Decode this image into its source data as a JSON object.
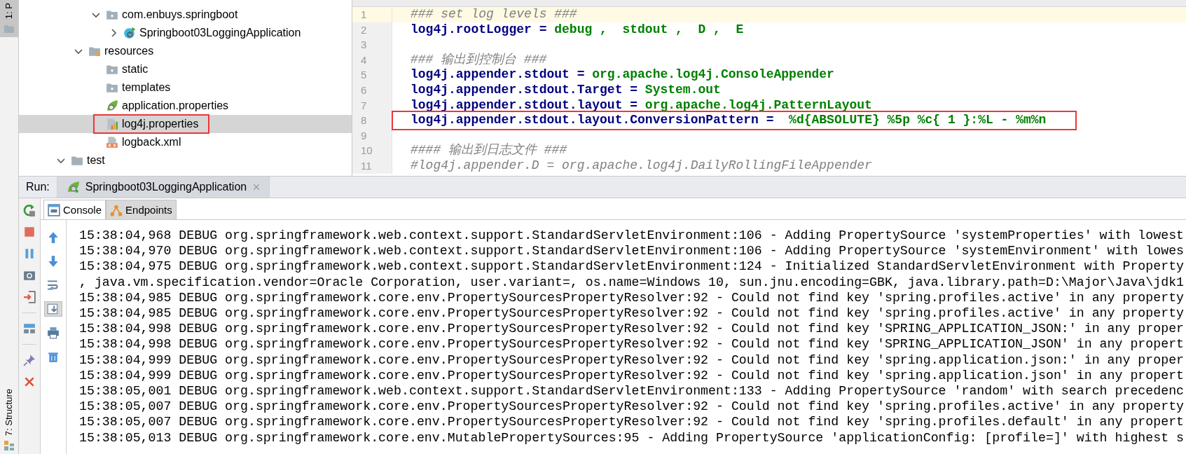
{
  "side_stripe": {
    "top_tab": {
      "label": "1: P",
      "selected": true
    },
    "bottom_tab": {
      "label": "7: Structure",
      "selected": false
    }
  },
  "project_tree": {
    "items": [
      {
        "children": [
          {
            "children": [
              {
                "label": "com.enbuys.springboot",
                "kind": "package",
                "expanded": true,
                "selected": false,
                "highlighted": false,
                "children": [
                  {
                    "label": "Springboot03LoggingApplication",
                    "kind": "spring-class",
                    "expanded": false,
                    "selected": false,
                    "highlighted": false
                  }
                ]
              }
            ]
          },
          {
            "label": "resources",
            "kind": "resources-folder",
            "expanded": true,
            "selected": false,
            "highlighted": false,
            "children": [
              {
                "label": "static",
                "kind": "package",
                "selected": false,
                "highlighted": false
              },
              {
                "label": "templates",
                "kind": "package",
                "selected": false,
                "highlighted": false
              },
              {
                "label": "application.properties",
                "kind": "spring-properties",
                "selected": false,
                "highlighted": false
              },
              {
                "label": "log4j.properties",
                "kind": "properties",
                "selected": true,
                "highlighted": true
              },
              {
                "label": "logback.xml",
                "kind": "xml",
                "selected": false,
                "highlighted": false
              }
            ]
          }
        ]
      },
      {
        "label": "test",
        "kind": "folder",
        "expanded": true,
        "selected": false,
        "highlighted": false
      }
    ]
  },
  "editor": {
    "lines": [
      {
        "number": "1",
        "kind": "comment",
        "text": "### set log levels ###",
        "current": true,
        "highlighted": false
      },
      {
        "number": "2",
        "kind": "property",
        "key": "log4j.rootLogger",
        "sep": " = ",
        "value": "debug ,  stdout ,  D ,  E",
        "current": false,
        "highlighted": false
      },
      {
        "number": "3",
        "kind": "blank",
        "current": false,
        "highlighted": false
      },
      {
        "number": "4",
        "kind": "comment",
        "text": "### 输出到控制台 ###",
        "current": false,
        "highlighted": false
      },
      {
        "number": "5",
        "kind": "property",
        "key": "log4j.appender.stdout",
        "sep": " = ",
        "value": "org.apache.log4j.ConsoleAppender",
        "current": false,
        "highlighted": false
      },
      {
        "number": "6",
        "kind": "property",
        "key": "log4j.appender.stdout.Target",
        "sep": " = ",
        "value": "System.out",
        "current": false,
        "highlighted": false
      },
      {
        "number": "7",
        "kind": "property",
        "key": "log4j.appender.stdout.layout",
        "sep": " = ",
        "value": "org.apache.log4j.PatternLayout",
        "current": false,
        "highlighted": false
      },
      {
        "number": "8",
        "kind": "property",
        "key": "log4j.appender.stdout.layout.ConversionPattern",
        "sep": " =  ",
        "value": "%d{ABSOLUTE} %5p %c{ 1 }:%L - %m%n",
        "current": false,
        "highlighted": true
      },
      {
        "number": "9",
        "kind": "blank",
        "current": false,
        "highlighted": false
      },
      {
        "number": "10",
        "kind": "comment",
        "text": "#### 输出到日志文件 ###",
        "current": false,
        "highlighted": false
      },
      {
        "number": "11",
        "kind": "comment",
        "text": "#log4j.appender.D = org.apache.log4j.DailyRollingFileAppender",
        "current": false,
        "highlighted": false
      }
    ]
  },
  "run_panel": {
    "label": "Run:",
    "tabs": [
      {
        "label": "Springboot03LoggingApplication",
        "selected": true
      }
    ],
    "tool_tabs": [
      {
        "label": "Console",
        "selected": true
      },
      {
        "label": "Endpoints",
        "selected": false
      }
    ],
    "scroll_to_end_on": true,
    "console_lines": [
      "15:38:04,968 DEBUG org.springframework.web.context.support.StandardServletEnvironment:106 - Adding PropertySource 'systemProperties' with lowest",
      "15:38:04,970 DEBUG org.springframework.web.context.support.StandardServletEnvironment:106 - Adding PropertySource 'systemEnvironment' with lowes",
      "15:38:04,975 DEBUG org.springframework.web.context.support.StandardServletEnvironment:124 - Initialized StandardServletEnvironment with Property",
      ", java.vm.specification.vendor=Oracle Corporation, user.variant=, os.name=Windows 10, sun.jnu.encoding=GBK, java.library.path=D:\\Major\\Java\\jdk1",
      "15:38:04,985 DEBUG org.springframework.core.env.PropertySourcesPropertyResolver:92 - Could not find key 'spring.profiles.active' in any property",
      "15:38:04,985 DEBUG org.springframework.core.env.PropertySourcesPropertyResolver:92 - Could not find key 'spring.profiles.active' in any property",
      "15:38:04,998 DEBUG org.springframework.core.env.PropertySourcesPropertyResolver:92 - Could not find key 'SPRING_APPLICATION_JSON:' in any proper",
      "15:38:04,998 DEBUG org.springframework.core.env.PropertySourcesPropertyResolver:92 - Could not find key 'SPRING_APPLICATION_JSON' in any propert",
      "15:38:04,999 DEBUG org.springframework.core.env.PropertySourcesPropertyResolver:92 - Could not find key 'spring.application.json:' in any proper",
      "15:38:04,999 DEBUG org.springframework.core.env.PropertySourcesPropertyResolver:92 - Could not find key 'spring.application.json' in any propert",
      "15:38:05,001 DEBUG org.springframework.web.context.support.StandardServletEnvironment:133 - Adding PropertySource 'random' with search precedenc",
      "15:38:05,007 DEBUG org.springframework.core.env.PropertySourcesPropertyResolver:92 - Could not find key 'spring.profiles.active' in any property",
      "15:38:05,007 DEBUG org.springframework.core.env.PropertySourcesPropertyResolver:92 - Could not find key 'spring.profiles.default' in any propert",
      "15:38:05,013 DEBUG org.springframework.core.env.MutablePropertySources:95 - Adding PropertySource 'applicationConfig: [profile=]' with highest s"
    ]
  }
}
